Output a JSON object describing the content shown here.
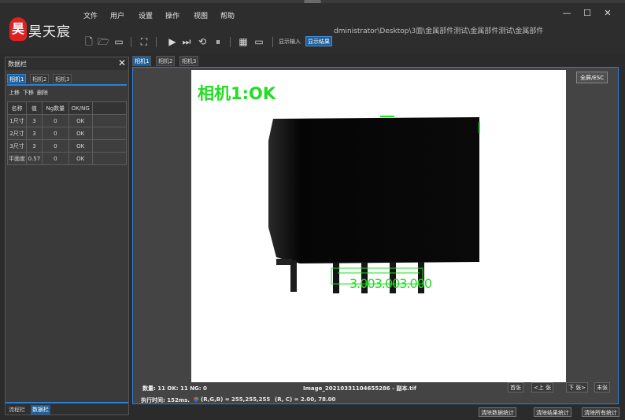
{
  "brand": {
    "logo_char": "昊",
    "name": "昊天宸"
  },
  "menu": [
    "文件",
    "用户",
    "设置",
    "操作",
    "视图",
    "帮助"
  ],
  "path_text": "dministrator\\Desktop\\3面\\金属部件测试\\金属部件测试\\金属部件",
  "window_controls": {
    "minimize": "—",
    "maximize": "☐",
    "close": "✕"
  },
  "toolbar": {
    "mode_label": "显示输入",
    "mode_active": "显示结果"
  },
  "data_panel": {
    "title": "数据栏",
    "close": "✕",
    "subtabs": [
      "相机1",
      "相机2",
      "相机3"
    ],
    "actions": [
      "上移",
      "下移",
      "删除"
    ],
    "columns": [
      "名称",
      "值",
      "Ng数量",
      "OK/NG"
    ],
    "rows": [
      [
        "1尺寸",
        "3",
        "0",
        "OK"
      ],
      [
        "2尺寸",
        "3",
        "0",
        "OK"
      ],
      [
        "3尺寸",
        "3",
        "0",
        "OK"
      ],
      [
        "平面度",
        "0.57",
        "0",
        "OK"
      ]
    ],
    "bottom_tabs": [
      "流程栏",
      "数据栏"
    ]
  },
  "camera_tabs": [
    "相机1",
    "相机2",
    "相机3"
  ],
  "viewer": {
    "result_text": "相机1:OK",
    "measurement_text": "3.003.003.000",
    "fullscreen_label": "全屏/ESC",
    "info_count": "数量: 11 OK: 11 NG: 0",
    "image_name": "Image_20210331104655286 - 副本.tif",
    "nav": [
      "首张",
      "<上 张",
      "下 张>",
      "末张"
    ],
    "exec_time": "执行时间: 152ms.",
    "rgb": "(R,G,B) = 255,255,255",
    "rc": "(R, C) = 2.00, 78.00"
  },
  "footer_buttons": [
    "清除数据统计",
    "清除结果统计",
    "清除所有统计"
  ],
  "colors": {
    "accent": "#2d7fd3",
    "ok_green": "#22dd22",
    "brand_red": "#dd2222"
  }
}
